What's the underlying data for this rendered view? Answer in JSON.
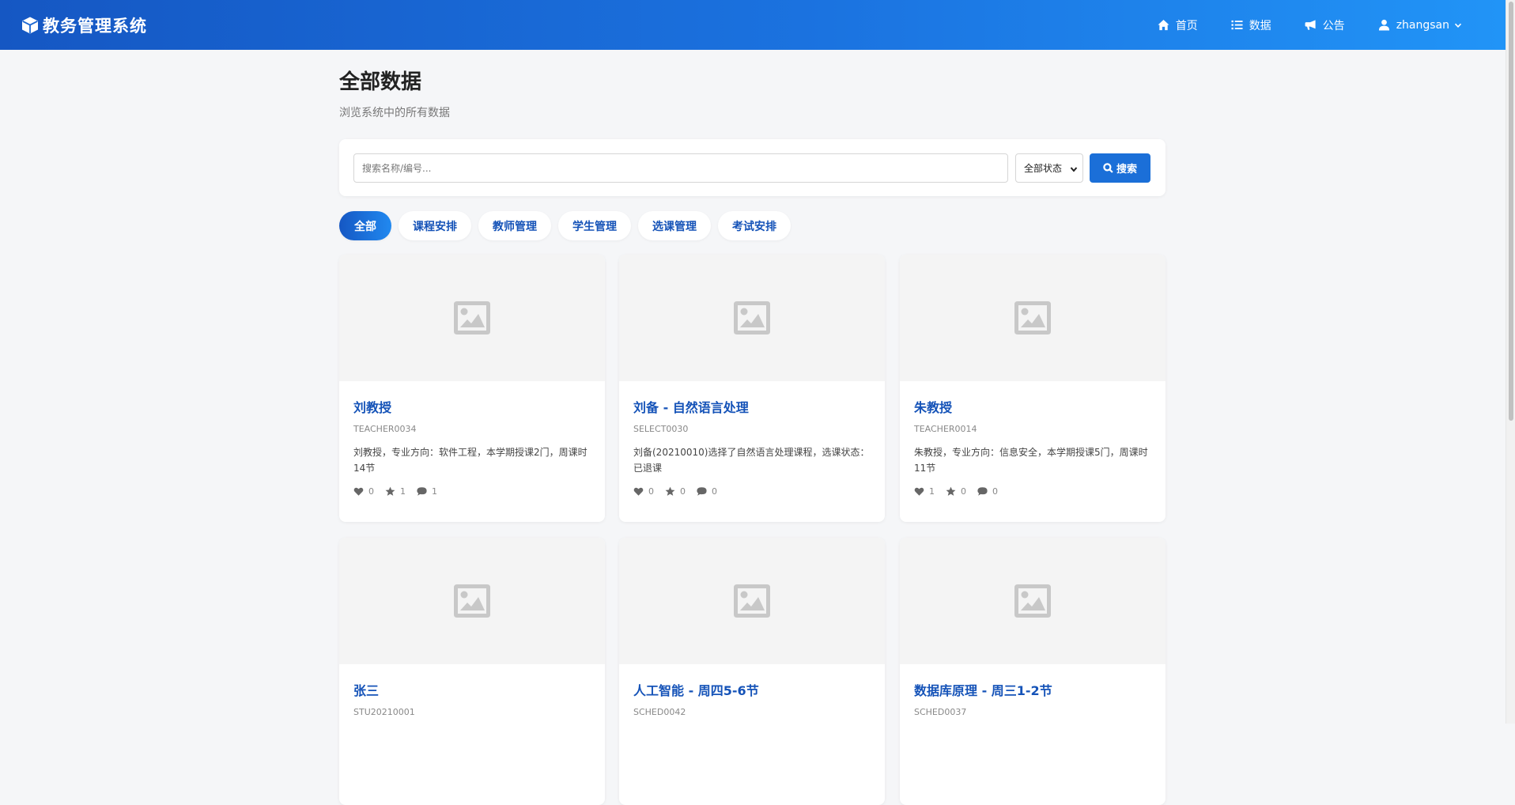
{
  "app": {
    "title": "教务管理系统",
    "logo_icon": "cube-icon"
  },
  "nav": {
    "items": [
      {
        "label": "首页",
        "icon": "home-icon"
      },
      {
        "label": "数据",
        "icon": "list-icon"
      },
      {
        "label": "公告",
        "icon": "bullhorn-icon"
      }
    ],
    "user": {
      "name": "zhangsan",
      "icon": "user-icon"
    }
  },
  "page": {
    "title": "全部数据",
    "subtitle": "浏览系统中的所有数据"
  },
  "search": {
    "placeholder": "搜索名称/编号...",
    "value": "",
    "status_selected": "全部状态",
    "button_label": "搜索"
  },
  "tabs": [
    {
      "label": "全部",
      "active": true
    },
    {
      "label": "课程安排",
      "active": false
    },
    {
      "label": "教师管理",
      "active": false
    },
    {
      "label": "学生管理",
      "active": false
    },
    {
      "label": "选课管理",
      "active": false
    },
    {
      "label": "考试安排",
      "active": false
    }
  ],
  "cards": [
    {
      "title": "刘教授",
      "code": "TEACHER0034",
      "desc": "刘教授，专业方向：软件工程，本学期授课2门，周课时14节",
      "likes": "0",
      "stars": "1",
      "comments": "1"
    },
    {
      "title": "刘备 - 自然语言处理",
      "code": "SELECT0030",
      "desc": "刘备(20210010)选择了自然语言处理课程，选课状态：已退课",
      "likes": "0",
      "stars": "0",
      "comments": "0"
    },
    {
      "title": "朱教授",
      "code": "TEACHER0014",
      "desc": "朱教授，专业方向：信息安全，本学期授课5门，周课时11节",
      "likes": "1",
      "stars": "0",
      "comments": "0"
    },
    {
      "title": "张三",
      "code": "STU20210001",
      "desc": "",
      "likes": "",
      "stars": "",
      "comments": ""
    },
    {
      "title": "人工智能 - 周四5-6节",
      "code": "SCHED0042",
      "desc": "",
      "likes": "",
      "stars": "",
      "comments": ""
    },
    {
      "title": "数据库原理 - 周三1-2节",
      "code": "SCHED0037",
      "desc": "",
      "likes": "",
      "stars": "",
      "comments": ""
    }
  ],
  "colors": {
    "primary": "#1b6fd8",
    "nav_start": "#1557c3",
    "nav_end": "#2194f7",
    "title_blue": "#1553b8"
  }
}
